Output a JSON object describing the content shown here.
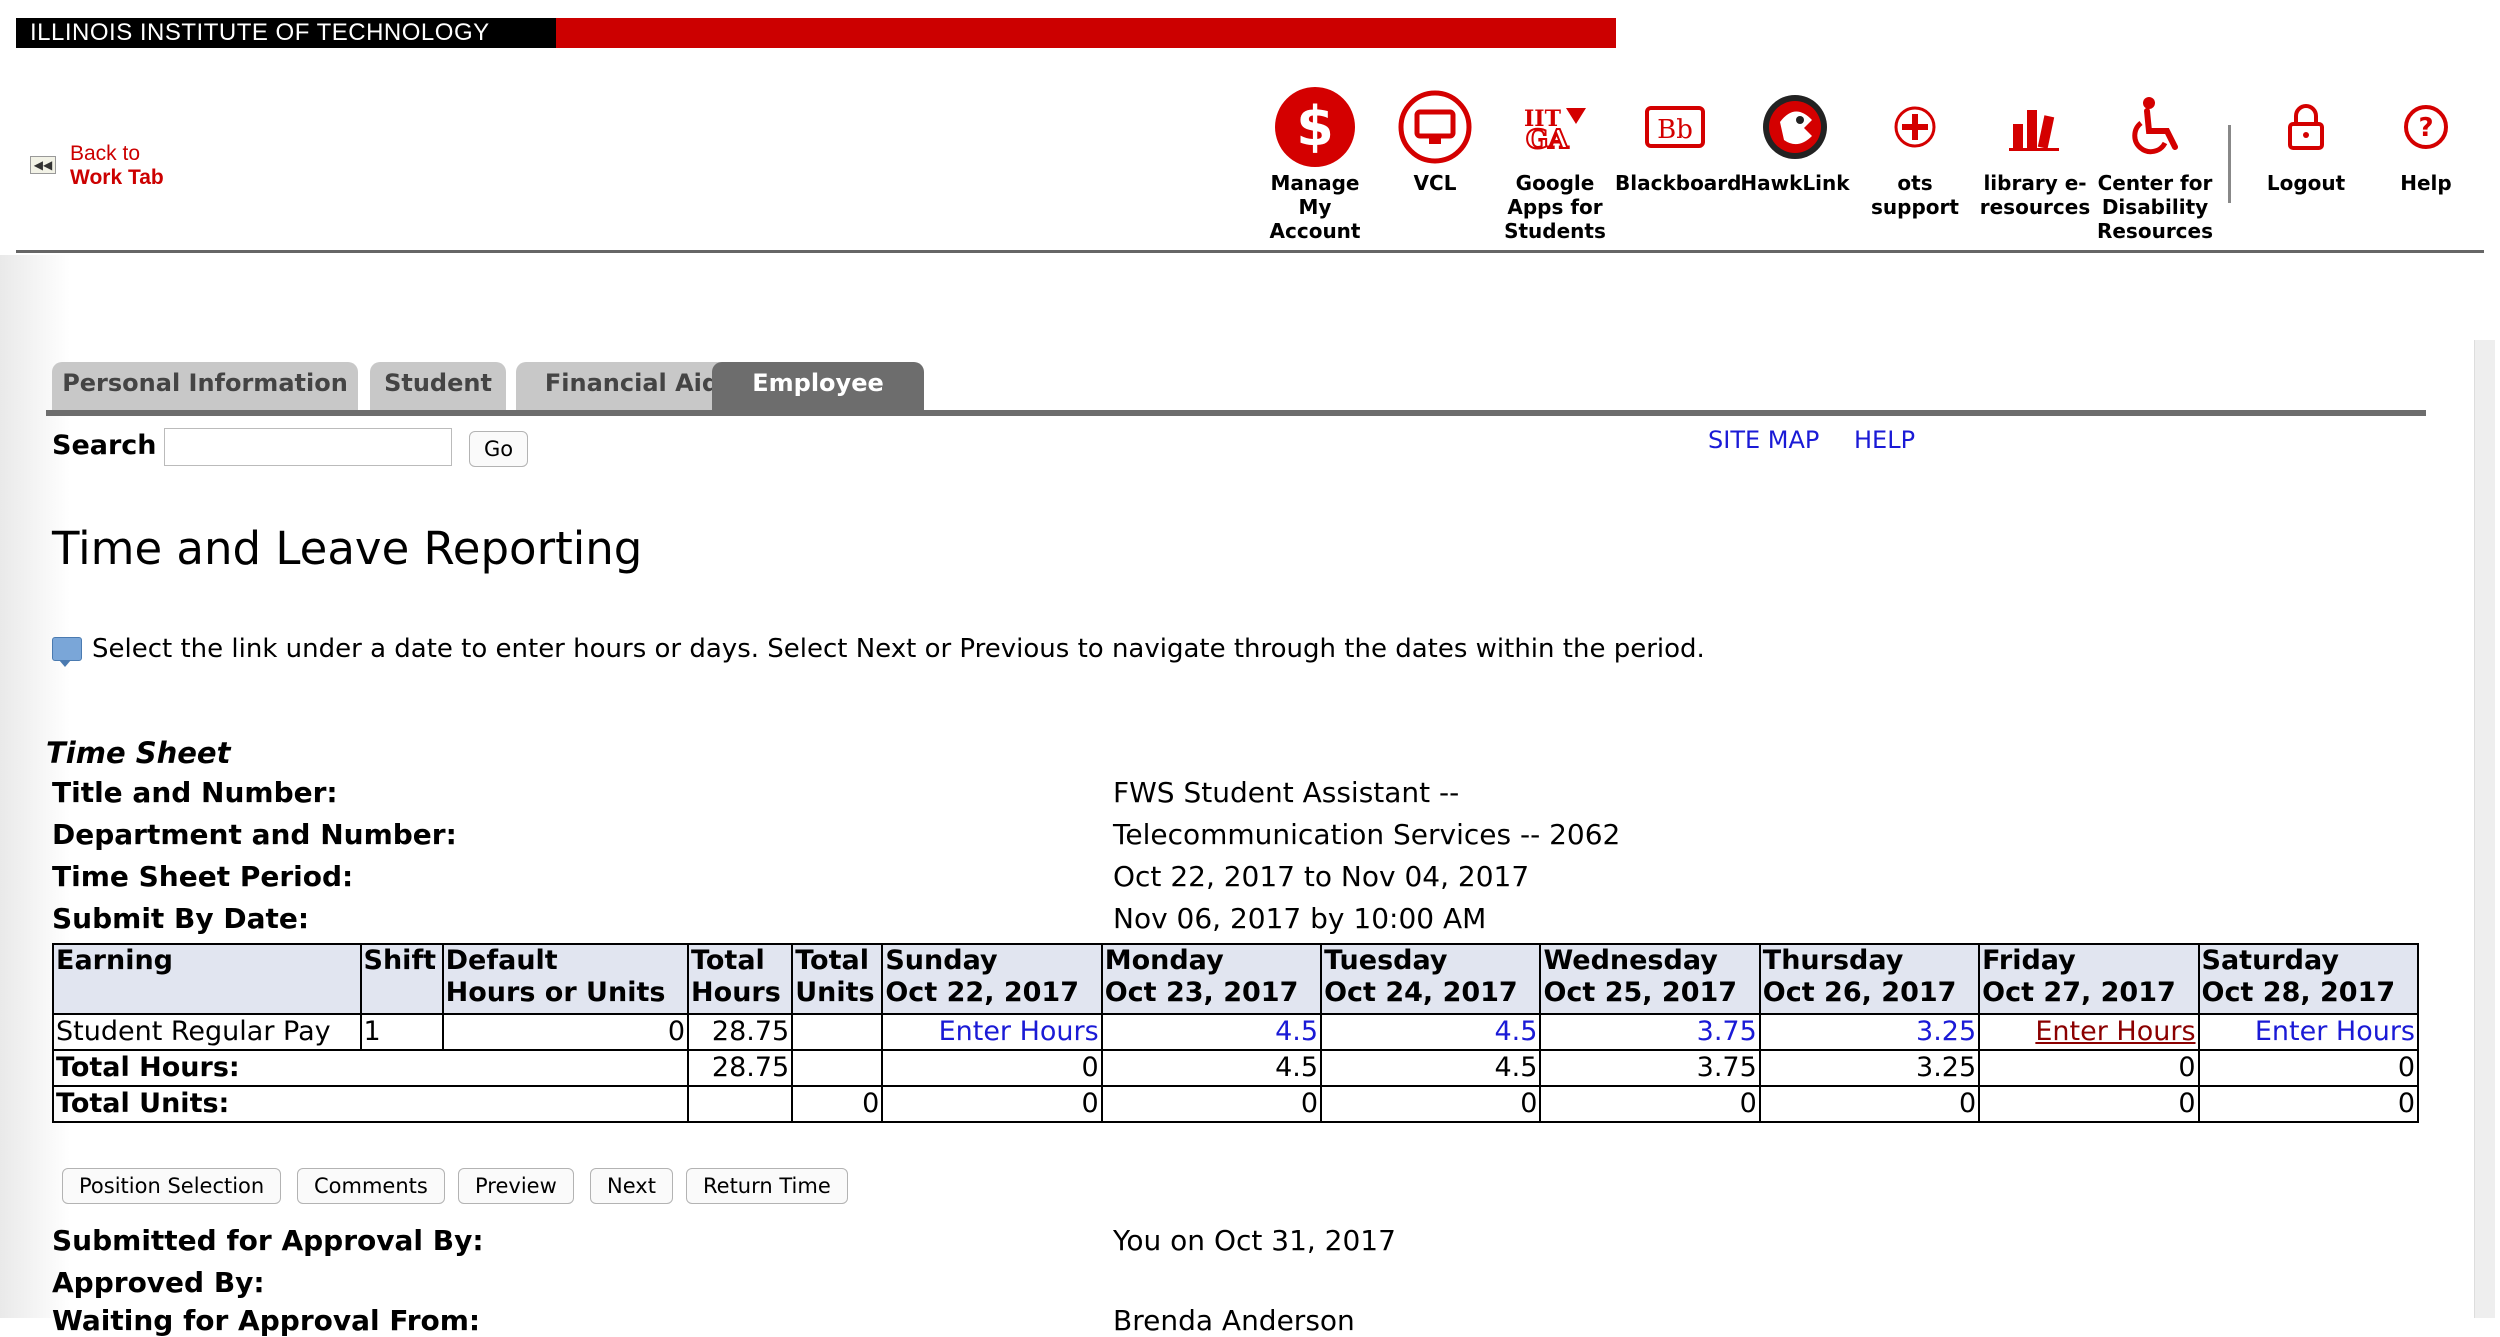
{
  "banner": {
    "title": "ILLINOIS INSTITUTE OF TECHNOLOGY"
  },
  "back_link": {
    "line1": "Back to",
    "line2": "Work Tab"
  },
  "toolbar": [
    {
      "label": "Manage My Account",
      "icon": "dollar-icon"
    },
    {
      "label": "VCL",
      "icon": "monitor-icon"
    },
    {
      "label": "Google Apps for Students",
      "icon": "google-apps-icon"
    },
    {
      "label": "Blackboard",
      "icon": "blackboard-icon"
    },
    {
      "label": "HawkLink",
      "icon": "hawk-icon"
    },
    {
      "label": "ots support",
      "icon": "plus-icon"
    },
    {
      "label": "library e-resources",
      "icon": "library-icon"
    },
    {
      "label": "Center for Disability Resources",
      "icon": "wheelchair-icon"
    },
    {
      "label": "Logout",
      "icon": "lock-icon"
    },
    {
      "label": "Help",
      "icon": "question-icon"
    }
  ],
  "tabs": [
    {
      "label": "Personal Information",
      "active": false
    },
    {
      "label": "Student",
      "active": false
    },
    {
      "label": "Financial Aid",
      "active": false
    },
    {
      "label": "Employee",
      "active": true
    }
  ],
  "search": {
    "label": "Search",
    "value": "",
    "go": "Go"
  },
  "top_links": {
    "site_map": "SITE MAP",
    "help": "HELP"
  },
  "page_title": "Time and Leave Reporting",
  "info_text": "Select the link under a date to enter hours or days. Select Next or Previous to navigate through the dates within the period.",
  "time_sheet": {
    "caption": "Time Sheet",
    "fields": [
      {
        "label": "Title and Number:",
        "value": "FWS Student Assistant --"
      },
      {
        "label": "Department and Number:",
        "value": "Telecommunication Services -- 2062"
      },
      {
        "label": "Time Sheet Period:",
        "value": "Oct 22, 2017 to Nov 04, 2017"
      },
      {
        "label": "Submit By Date:",
        "value": "Nov 06, 2017 by 10:00 AM"
      }
    ]
  },
  "grid": {
    "headers": {
      "earning": "Earning",
      "shift": "Shift",
      "default_line1": "Default",
      "default_line2": "Hours or Units",
      "total_hours_line1": "Total",
      "total_hours_line2": "Hours",
      "total_units_line1": "Total",
      "total_units_line2": "Units"
    },
    "days": [
      {
        "day": "Sunday",
        "date": "Oct 22, 2017"
      },
      {
        "day": "Monday",
        "date": "Oct 23, 2017"
      },
      {
        "day": "Tuesday",
        "date": "Oct 24, 2017"
      },
      {
        "day": "Wednesday",
        "date": "Oct 25, 2017"
      },
      {
        "day": "Thursday",
        "date": "Oct 26, 2017"
      },
      {
        "day": "Friday",
        "date": "Oct 27, 2017"
      },
      {
        "day": "Saturday",
        "date": "Oct 28, 2017"
      }
    ],
    "earning_row": {
      "earning": "Student Regular Pay",
      "shift": "1",
      "default": "0",
      "total_hours": "28.75",
      "total_units": "",
      "cells": [
        "Enter Hours",
        "4.5",
        "4.5",
        "3.75",
        "3.25",
        "Enter Hours",
        "Enter Hours"
      ]
    },
    "total_hours_row": {
      "label": "Total Hours:",
      "total": "28.75",
      "cells": [
        "0",
        "4.5",
        "4.5",
        "3.75",
        "3.25",
        "0",
        "0"
      ]
    },
    "total_units_row": {
      "label": "Total Units:",
      "units": "0",
      "cells": [
        "0",
        "0",
        "0",
        "0",
        "0",
        "0",
        "0"
      ]
    }
  },
  "buttons": {
    "position_selection": "Position Selection",
    "comments": "Comments",
    "preview": "Preview",
    "next": "Next",
    "return_time": "Return Time"
  },
  "approval": [
    {
      "label": "Submitted for Approval By:",
      "value": "You on Oct 31, 2017"
    },
    {
      "label": "Approved By:",
      "value": ""
    },
    {
      "label": "Waiting for Approval From:",
      "value": "Brenda Anderson"
    }
  ],
  "colors": {
    "brand_red": "#cc0000",
    "link_blue": "#1a1ad6",
    "tab_active": "#6d6d6d",
    "header_bg": "#e1e5f0"
  }
}
